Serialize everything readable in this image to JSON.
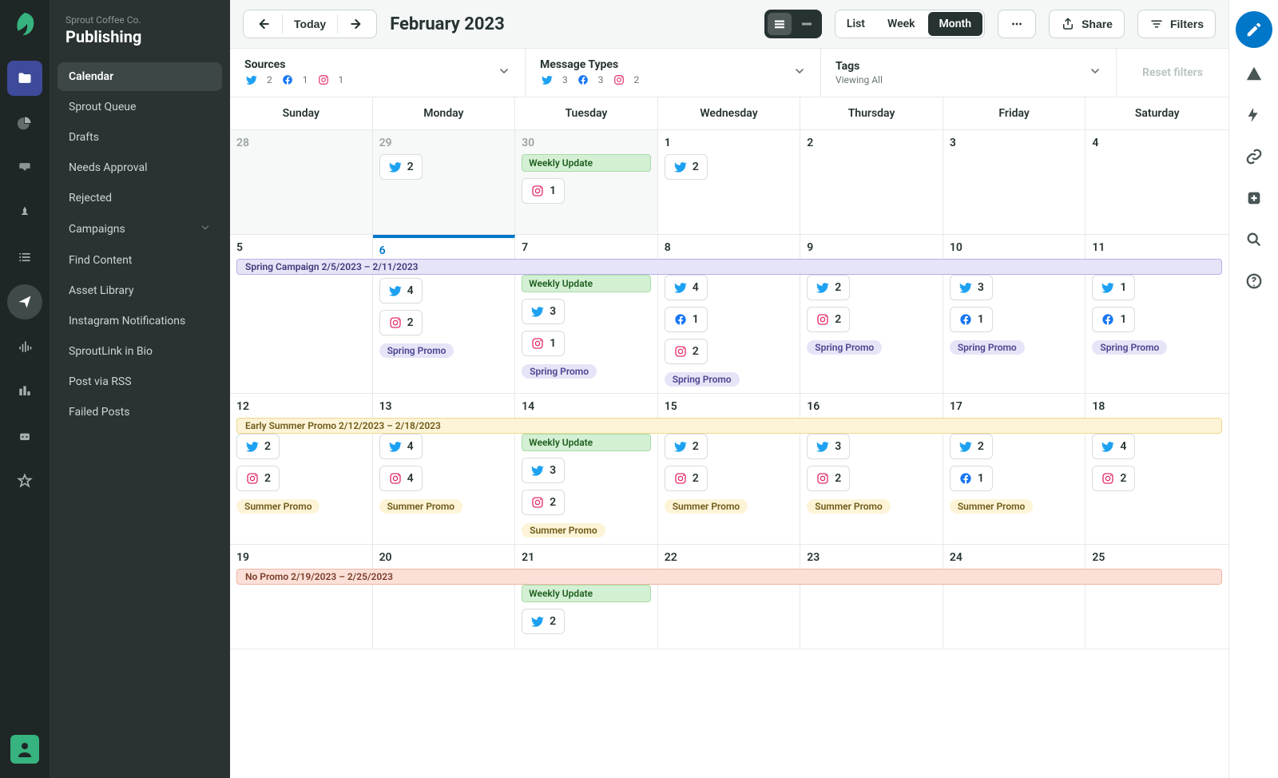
{
  "company": {
    "name": "Sprout Coffee Co.",
    "section": "Publishing"
  },
  "sidebar": {
    "items": [
      {
        "label": "Calendar",
        "active": true
      },
      {
        "label": "Sprout Queue"
      },
      {
        "label": "Drafts"
      },
      {
        "label": "Needs Approval"
      },
      {
        "label": "Rejected"
      },
      {
        "label": "Campaigns",
        "chevron": true
      },
      {
        "label": "Find Content"
      },
      {
        "label": "Asset Library"
      },
      {
        "label": "Instagram Notifications"
      },
      {
        "label": "SproutLink in Bio"
      },
      {
        "label": "Post via RSS"
      },
      {
        "label": "Failed Posts"
      }
    ]
  },
  "toolbar": {
    "today": "Today",
    "month_label": "February 2023",
    "views": {
      "list": "List",
      "week": "Week",
      "month": "Month",
      "active": "Month"
    },
    "share": "Share",
    "filters": "Filters"
  },
  "filters": {
    "sources": {
      "title": "Sources",
      "twitter": "2",
      "facebook": "1",
      "instagram": "1"
    },
    "message_types": {
      "title": "Message Types",
      "twitter": "3",
      "facebook": "3",
      "instagram": "2"
    },
    "tags": {
      "title": "Tags",
      "sub": "Viewing All"
    },
    "reset": "Reset filters"
  },
  "days": [
    "Sunday",
    "Monday",
    "Tuesday",
    "Wednesday",
    "Thursday",
    "Friday",
    "Saturday"
  ],
  "weeks": [
    {
      "cells": [
        {
          "num": "28",
          "other": true
        },
        {
          "num": "29",
          "other": true,
          "pills": [
            [
              "tw",
              "2"
            ]
          ]
        },
        {
          "num": "30",
          "other": true,
          "weekly": "Weekly Update",
          "pills": [
            [
              "ig",
              "1"
            ]
          ]
        },
        {
          "num": "1",
          "pills": [
            [
              "tw",
              "2"
            ]
          ]
        },
        {
          "num": "2"
        },
        {
          "num": "3"
        },
        {
          "num": "4"
        }
      ]
    },
    {
      "campaign": {
        "class": "campaign-spring",
        "label": "Spring Campaign 2/5/2023 – 2/11/2023"
      },
      "cells": [
        {
          "num": "5"
        },
        {
          "num": "6",
          "today": true,
          "pills": [
            [
              "tw",
              "4"
            ],
            [
              "ig",
              "2"
            ]
          ],
          "promo": "Spring Promo"
        },
        {
          "num": "7",
          "weekly": "Weekly Update",
          "pills": [
            [
              "tw",
              "3"
            ],
            [
              "ig",
              "1"
            ]
          ],
          "promo": "Spring Promo"
        },
        {
          "num": "8",
          "pills": [
            [
              "tw",
              "4"
            ],
            [
              "fb",
              "1"
            ],
            [
              "ig",
              "2"
            ]
          ],
          "promo": "Spring Promo"
        },
        {
          "num": "9",
          "pills": [
            [
              "tw",
              "2"
            ],
            [
              "ig",
              "2"
            ]
          ],
          "promo": "Spring Promo"
        },
        {
          "num": "10",
          "pills": [
            [
              "tw",
              "3"
            ],
            [
              "fb",
              "1"
            ]
          ],
          "promo": "Spring Promo"
        },
        {
          "num": "11",
          "pills": [
            [
              "tw",
              "1"
            ],
            [
              "fb",
              "1"
            ]
          ],
          "promo": "Spring Promo"
        }
      ]
    },
    {
      "campaign": {
        "class": "campaign-summer",
        "label": "Early Summer Promo 2/12/2023 – 2/18/2023"
      },
      "cells": [
        {
          "num": "12",
          "pills": [
            [
              "tw",
              "2"
            ],
            [
              "ig",
              "2"
            ]
          ],
          "promo": "Summer Promo",
          "promoClass": "summer"
        },
        {
          "num": "13",
          "pills": [
            [
              "tw",
              "4"
            ],
            [
              "ig",
              "4"
            ]
          ],
          "promo": "Summer Promo",
          "promoClass": "summer"
        },
        {
          "num": "14",
          "weekly": "Weekly Update",
          "pills": [
            [
              "tw",
              "3"
            ],
            [
              "ig",
              "2"
            ]
          ],
          "promo": "Summer Promo",
          "promoClass": "summer"
        },
        {
          "num": "15",
          "pills": [
            [
              "tw",
              "2"
            ],
            [
              "ig",
              "2"
            ]
          ],
          "promo": "Summer Promo",
          "promoClass": "summer"
        },
        {
          "num": "16",
          "pills": [
            [
              "tw",
              "3"
            ],
            [
              "ig",
              "2"
            ]
          ],
          "promo": "Summer Promo",
          "promoClass": "summer"
        },
        {
          "num": "17",
          "pills": [
            [
              "tw",
              "2"
            ],
            [
              "fb",
              "1"
            ]
          ],
          "promo": "Summer Promo",
          "promoClass": "summer"
        },
        {
          "num": "18",
          "pills": [
            [
              "tw",
              "4"
            ],
            [
              "ig",
              "2"
            ]
          ]
        }
      ]
    },
    {
      "campaign": {
        "class": "campaign-nopromo",
        "label": "No Promo 2/19/2023 – 2/25/2023"
      },
      "cells": [
        {
          "num": "19"
        },
        {
          "num": "20"
        },
        {
          "num": "21",
          "weekly": "Weekly Update",
          "pills": [
            [
              "tw",
              "2"
            ]
          ]
        },
        {
          "num": "22"
        },
        {
          "num": "23"
        },
        {
          "num": "24"
        },
        {
          "num": "25"
        }
      ]
    }
  ]
}
